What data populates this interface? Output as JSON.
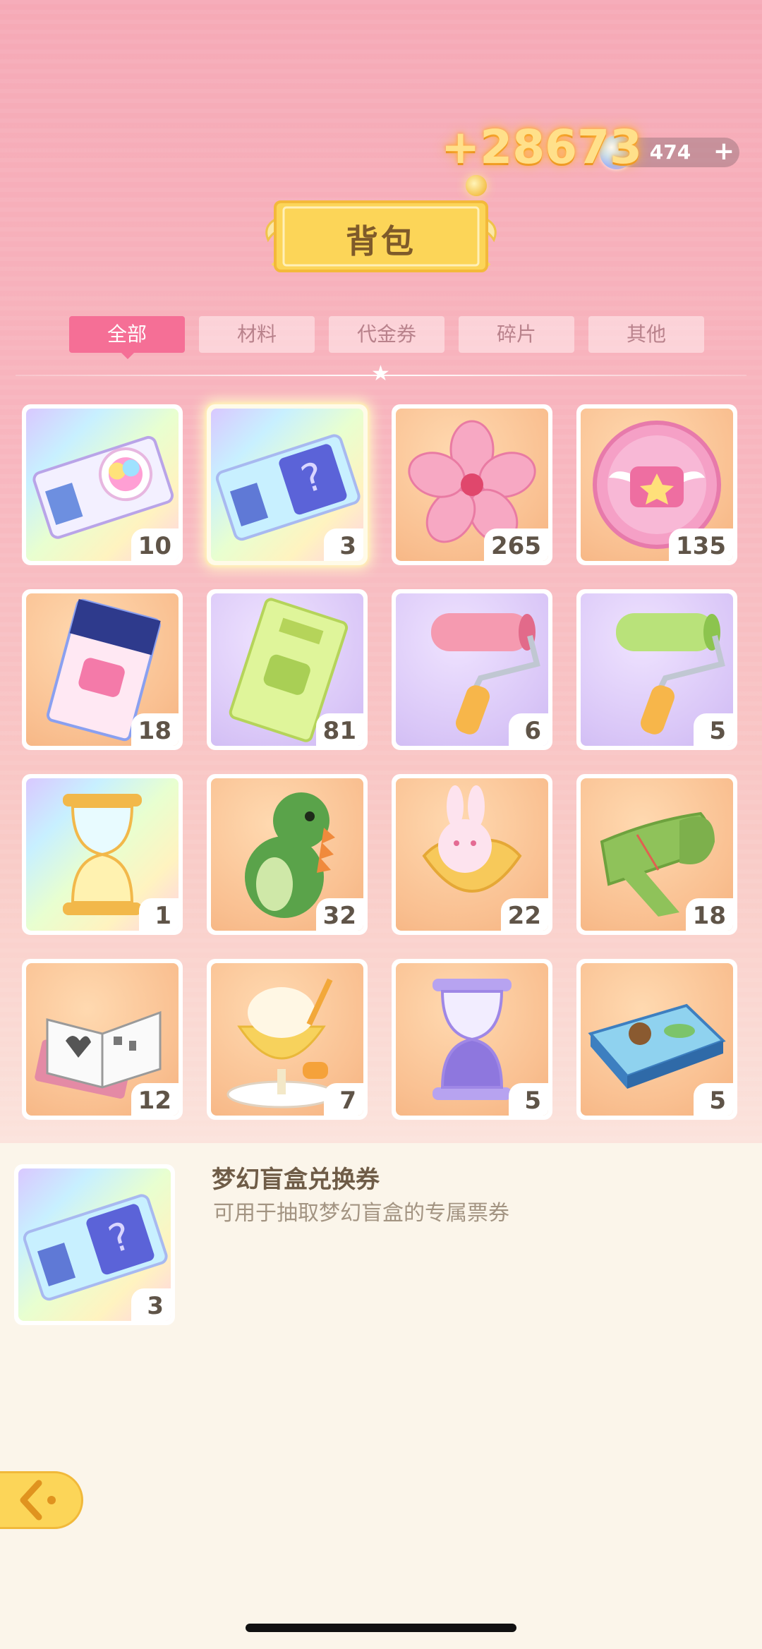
{
  "header": {
    "reward_popup": "+28673",
    "currency_value": "474",
    "plus_label": "+",
    "title": "背包"
  },
  "tabs": [
    {
      "label": "全部",
      "active": true
    },
    {
      "label": "材料",
      "active": false
    },
    {
      "label": "代金券",
      "active": false
    },
    {
      "label": "碎片",
      "active": false
    },
    {
      "label": "其他",
      "active": false
    }
  ],
  "items": [
    {
      "icon": "rainbow-ticket-icon",
      "count": "10"
    },
    {
      "icon": "mystery-ticket-icon",
      "count": "3",
      "selected": true
    },
    {
      "icon": "sakura-flower-icon",
      "count": "265"
    },
    {
      "icon": "pink-badge-icon",
      "count": "135"
    },
    {
      "icon": "blue-ticket-icon",
      "count": "18"
    },
    {
      "icon": "green-ticket-icon",
      "count": "81"
    },
    {
      "icon": "pink-paint-roller-icon",
      "count": "6"
    },
    {
      "icon": "green-paint-roller-icon",
      "count": "5"
    },
    {
      "icon": "golden-hourglass-icon",
      "count": "1"
    },
    {
      "icon": "dinosaur-plush-icon",
      "count": "32"
    },
    {
      "icon": "bunny-pouch-icon",
      "count": "22"
    },
    {
      "icon": "green-scarf-icon",
      "count": "18"
    },
    {
      "icon": "coloring-book-icon",
      "count": "12"
    },
    {
      "icon": "mango-parfait-icon",
      "count": "7"
    },
    {
      "icon": "purple-hourglass-icon",
      "count": "5"
    },
    {
      "icon": "puzzle-box-icon",
      "count": "5"
    }
  ],
  "detail": {
    "icon": "mystery-ticket-icon",
    "count": "3",
    "name": "梦幻盲盒兑换券",
    "description": "可用于抽取梦幻盲盒的专属票券"
  },
  "colors": {
    "accent_pink": "#f56f96",
    "title_gold": "#fcd558",
    "panel_bg": "#fbf5ea"
  }
}
